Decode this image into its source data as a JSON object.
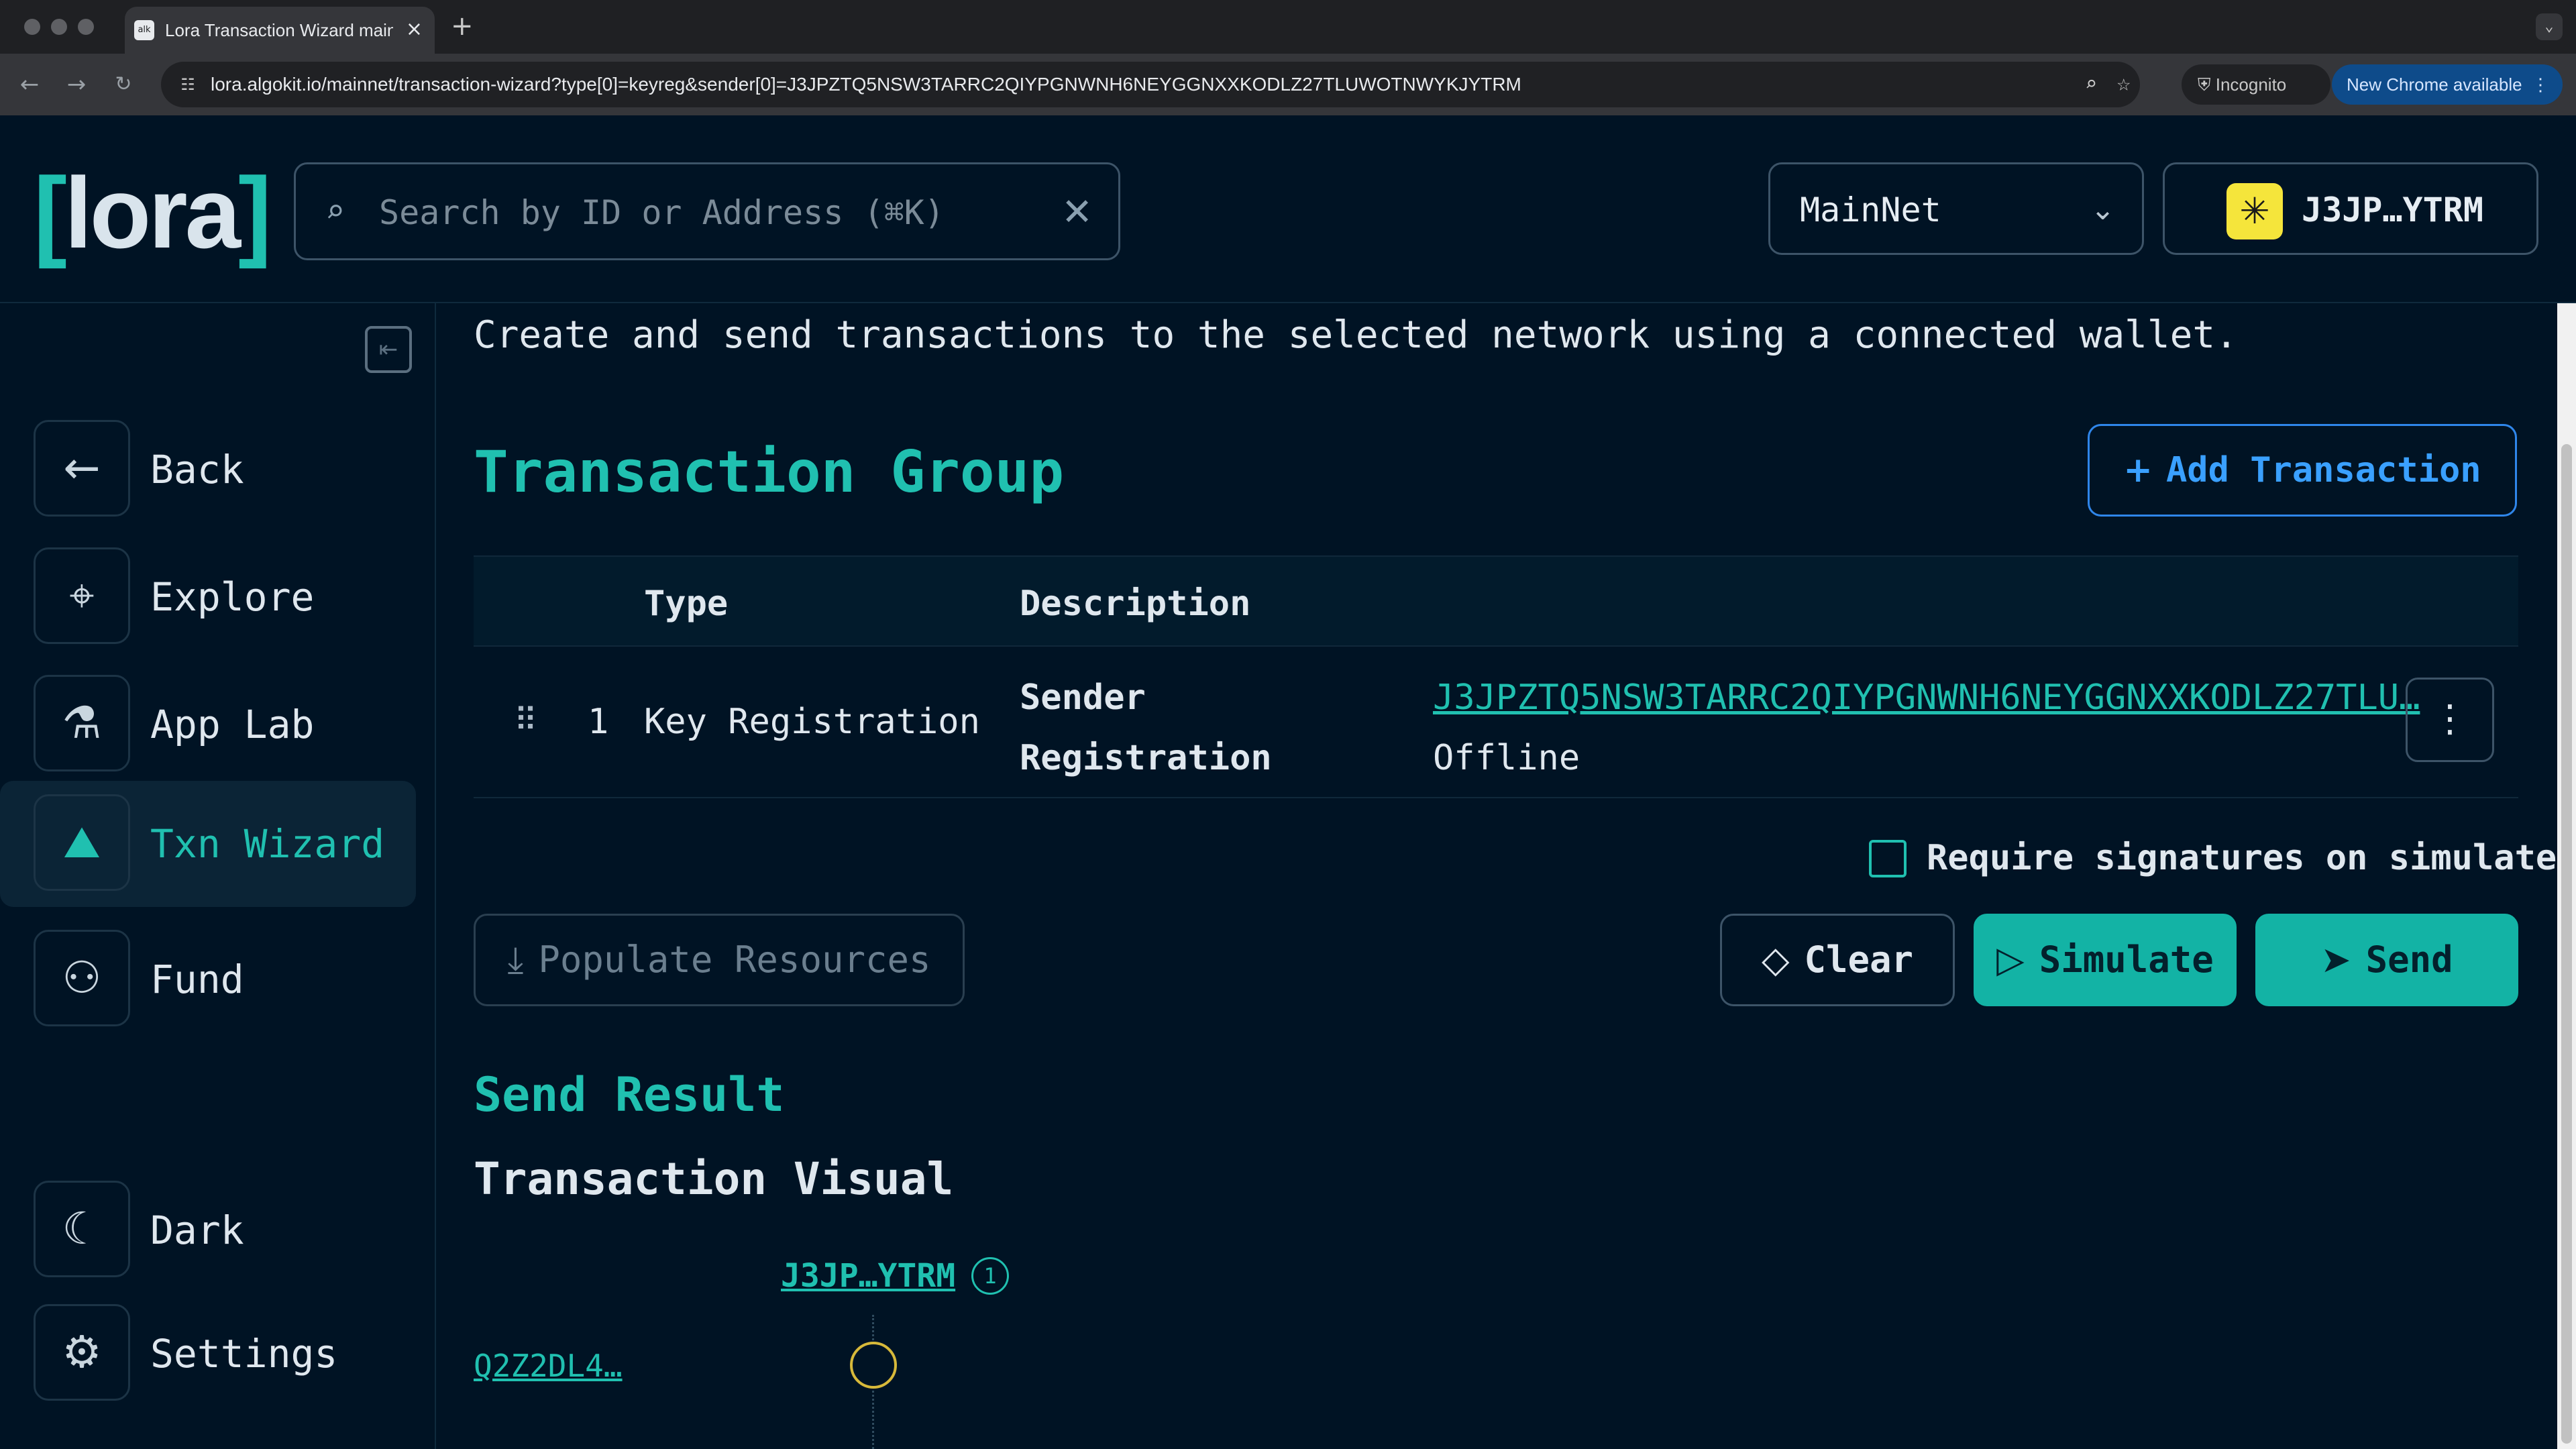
{
  "browser": {
    "tab_title": "Lora Transaction Wizard mainnet",
    "favicon_text": "alk",
    "url": "lora.algokit.io/mainnet/transaction-wizard?type[0]=keyreg&sender[0]=J3JPZTQ5NSW3TARRC2QIYPGNWNH6NEYGGNXXKODLZ27TLUWOTNWYKJYTRM",
    "incognito_label": "Incognito",
    "update_label": "New Chrome available"
  },
  "header": {
    "logo_left": "[",
    "logo_text": "lora",
    "logo_right": "]",
    "search_placeholder": "Search by ID or Address (⌘K)",
    "network": "MainNet",
    "wallet_address": "J3JP…YTRM"
  },
  "sidebar": {
    "items": [
      {
        "label": "Back",
        "icon": "arrow-left-icon"
      },
      {
        "label": "Explore",
        "icon": "telescope-icon"
      },
      {
        "label": "App Lab",
        "icon": "flask-icon"
      },
      {
        "label": "Txn Wizard",
        "icon": "wizard-hat-icon",
        "active": true
      },
      {
        "label": "Fund",
        "icon": "coins-icon"
      },
      {
        "label": "Dark",
        "icon": "moon-icon"
      },
      {
        "label": "Settings",
        "icon": "gear-icon"
      }
    ]
  },
  "main": {
    "intro": "Create and send transactions to the selected network using a connected wallet.",
    "group_title": "Transaction Group",
    "add_transaction": "Add Transaction",
    "table": {
      "headers": [
        "Type",
        "Description"
      ],
      "rows": [
        {
          "index": "1",
          "type": "Key Registration",
          "fields": [
            {
              "label": "Sender",
              "value": "J3JPZTQ5NSW3TARRC2QIYPGNWNH6NEYGGNXXKODLZ27TLU…"
            },
            {
              "label": "Registration",
              "value": "Offline"
            }
          ]
        }
      ]
    },
    "require_signatures": "Require signatures on simulate",
    "populate_resources": "Populate Resources",
    "clear": "Clear",
    "simulate": "Simulate",
    "send": "Send",
    "send_result": "Send Result",
    "transaction_visual": "Transaction Visual",
    "visual": {
      "account": "J3JP…YTRM",
      "account_count": "1",
      "txn_id": "Q2Z2DL4…"
    }
  }
}
